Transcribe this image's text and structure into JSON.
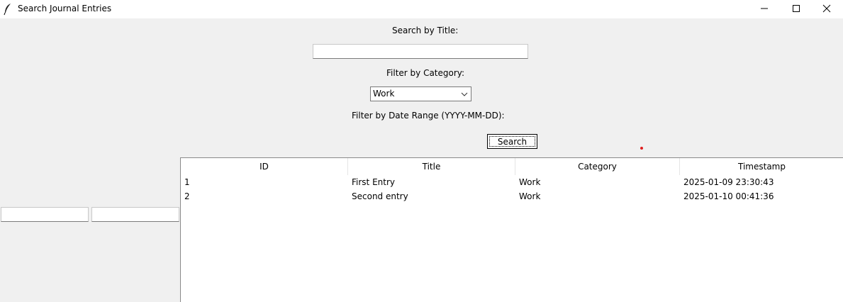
{
  "window": {
    "title": "Search Journal Entries",
    "app_icon": "feather-icon",
    "controls": [
      "minimize-icon",
      "maximize-icon",
      "close-icon"
    ]
  },
  "search": {
    "title_label": "Search by Title:",
    "title_value": "",
    "category_label": "Filter by Category:",
    "category_selected": "Work",
    "date_label": "Filter by Date Range (YYYY-MM-DD):",
    "date_start_value": "",
    "date_end_value": "",
    "button_label": "Search"
  },
  "results": {
    "columns": [
      "ID",
      "Title",
      "Category",
      "Timestamp"
    ],
    "rows": [
      {
        "id": "1",
        "title": "First Entry",
        "category": "Work",
        "timestamp": "2025-01-09 23:30:43"
      },
      {
        "id": "2",
        "title": "Second entry",
        "category": "Work",
        "timestamp": "2025-01-10 00:41:36"
      }
    ]
  },
  "colors": {
    "window_bg": "#f0f0f0",
    "titlebar_bg": "#ffffff",
    "marker": "#e02020"
  }
}
